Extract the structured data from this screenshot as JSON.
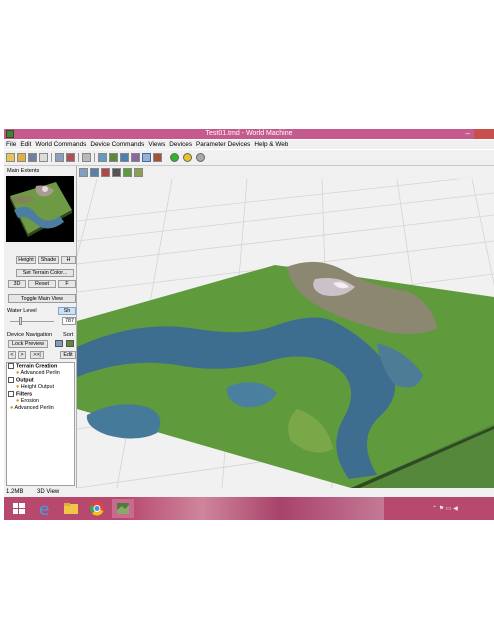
{
  "window": {
    "title": "Test01.tmd - World Machine",
    "minimize_glyph": "–",
    "titlebar_color": "#c45a8d"
  },
  "menu": {
    "items": [
      "File",
      "Edit",
      "World Commands",
      "Device Commands",
      "Views",
      "Devices",
      "Parameter Devices",
      "Help & Web"
    ]
  },
  "toolbar": {
    "icons": [
      "new-file-icon",
      "open-folder-icon",
      "save-icon",
      "pointer-icon",
      "chart-icon",
      "image-icon",
      "settings-icon",
      "grid-icon",
      "terrain-icon",
      "globe-icon",
      "layers-icon",
      "terrain-view-icon",
      "paint-icon",
      "green-build-icon",
      "yellow-build-icon",
      "gray-build-icon"
    ]
  },
  "left_panel": {
    "main_extents_label": "Main Extents",
    "height_btn": "Height",
    "shade_btn": "Shade",
    "h_btn": "H",
    "set_terrain_color_btn": "Set Terrain Color...",
    "btn_3d": "3D",
    "reset_btn": "Reset",
    "f_btn": "F",
    "toggle_main_view_btn": "Toggle Main View",
    "water_level_label": "Water Level",
    "water_level_value": "Sh",
    "slider_value": "787",
    "device_navigation_label": "Device Navigation",
    "sort_label": "Sort",
    "lock_preview_btn": "Lock Preview",
    "nav_prev": "<",
    "nav_next": ">",
    "nav_last": ">>|",
    "edit_btn": "Edit",
    "tree": {
      "terrain_creation": "Terrain Creation",
      "advanced_perlin_1": "Advanced Perlin",
      "output": "Output",
      "height_output": "Height Output",
      "filters": "Filters",
      "erosion": "Erosion",
      "advanced_perlin_2": "Advanced Perlin"
    }
  },
  "status": {
    "memory": "1.2MB",
    "view": "3D View"
  },
  "colors": {
    "accent": "#c45a8d",
    "taskbar": "#b7486e",
    "grass": "#5f9a3c",
    "water": "#3d6e8f",
    "snow": "#c9c2c8"
  }
}
